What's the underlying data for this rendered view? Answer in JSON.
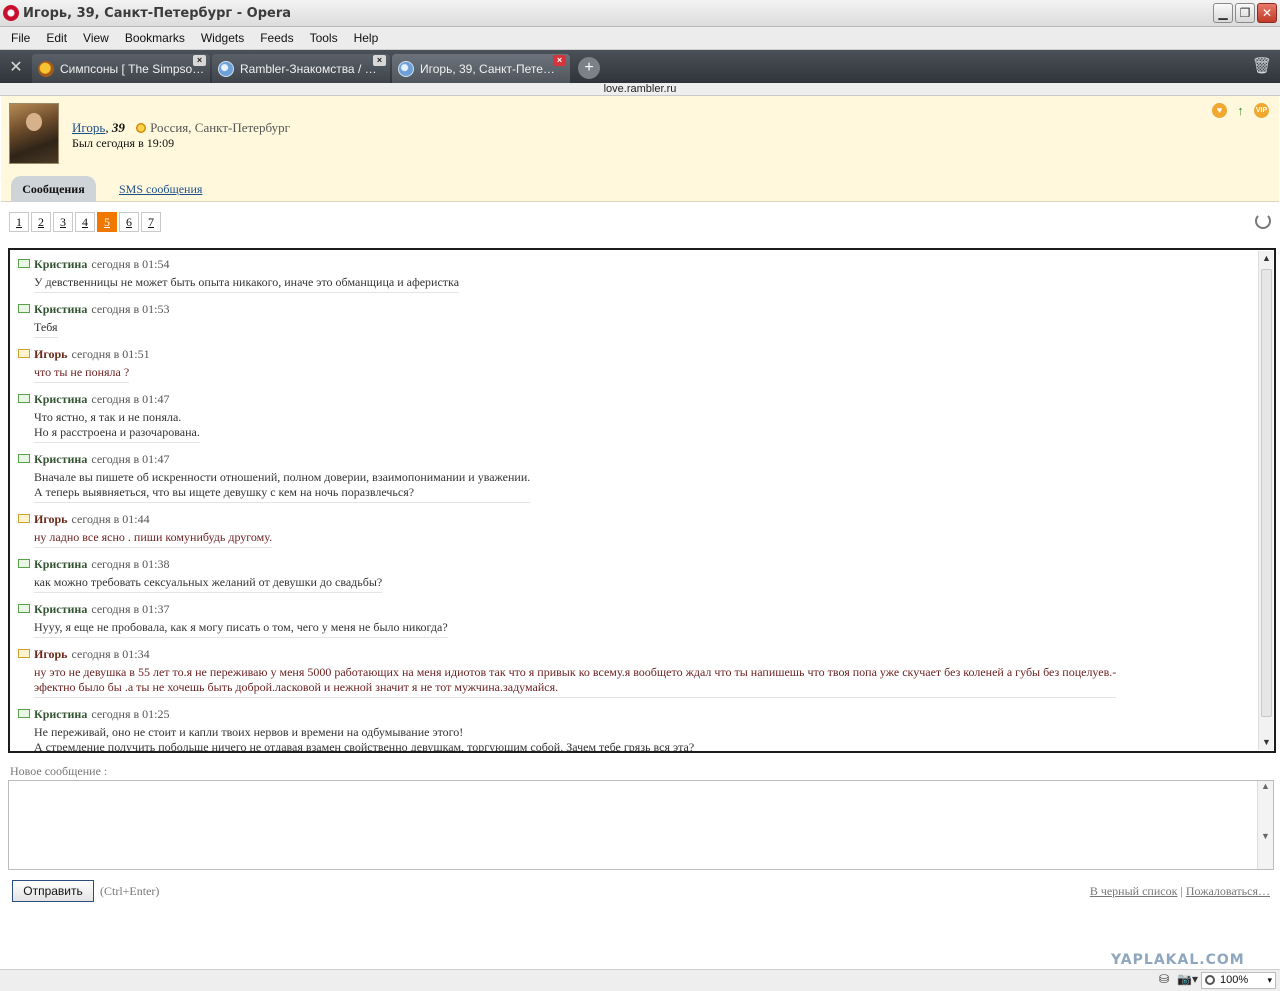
{
  "window": {
    "title": "Игорь, 39, Санкт-Петербург - Opera"
  },
  "menu": [
    "File",
    "Edit",
    "View",
    "Bookmarks",
    "Widgets",
    "Feeds",
    "Tools",
    "Help"
  ],
  "tabs": [
    {
      "label": "Симпсоны [ The Simpso…",
      "active": false
    },
    {
      "label": "Rambler-Знакомства / …",
      "active": false
    },
    {
      "label": "Игорь, 39, Санкт-Пете…",
      "active": true
    }
  ],
  "address": "love.rambler.ru",
  "profile": {
    "name": "Игорь",
    "separator": ",",
    "age": "39",
    "location": "Россия, Санкт-Петербург",
    "last_seen": "Был сегодня в 19:09"
  },
  "section_tabs": {
    "messages": "Сообщения",
    "sms": "SMS сообщения"
  },
  "pager": {
    "pages": [
      "1",
      "2",
      "3",
      "4",
      "5",
      "6",
      "7"
    ],
    "active": "5"
  },
  "messages": [
    {
      "author": "Кристина",
      "time": "сегодня в 01:54",
      "me": false,
      "lines": [
        "У девственницы не может быть опыта никакого, иначе это обманщица и аферистка"
      ]
    },
    {
      "author": "Кристина",
      "time": "сегодня в 01:53",
      "me": false,
      "lines": [
        "Тебя"
      ]
    },
    {
      "author": "Игорь",
      "time": "сегодня в 01:51",
      "me": true,
      "lines": [
        "что ты не поняла ?"
      ]
    },
    {
      "author": "Кристина",
      "time": "сегодня в 01:47",
      "me": false,
      "lines": [
        "Что ястно, я так и не поняла.",
        "Но я расстроена и разочарована."
      ]
    },
    {
      "author": "Кристина",
      "time": "сегодня в 01:47",
      "me": false,
      "lines": [
        "Вначале вы пишете об искренности отношений, полном доверии, взаимопонимании и уважении.",
        "А теперь выявняеться, что вы ищете девушку с кем на ночь поразвлечься?"
      ]
    },
    {
      "author": "Игорь",
      "time": "сегодня в 01:44",
      "me": true,
      "lines": [
        "ну ладно все ясно . пиши комунибудь другому."
      ]
    },
    {
      "author": "Кристина",
      "time": "сегодня в 01:38",
      "me": false,
      "lines": [
        "как можно требовать сексуальных желаний от девушки до свадьбы?"
      ]
    },
    {
      "author": "Кристина",
      "time": "сегодня в 01:37",
      "me": false,
      "lines": [
        "Нууу, я еще не пробовала, как я могу писать о том, чего у меня не было никогда?"
      ]
    },
    {
      "author": "Игорь",
      "time": "сегодня в 01:34",
      "me": true,
      "lines": [
        "ну это не девушка в 55 лет то.я не переживаю у меня 5000 работающих на меня идиотов так что я привык ко всему.я вообщето ждал что ты напишешь что твоя попа уже скучает без коленей а губы без поцелуев.-",
        "эфектно было бы .а ты не хочешь быть доброй.ласковой и нежной значит я не тот мужчина.задумайся."
      ]
    },
    {
      "author": "Кристина",
      "time": "сегодня в 01:25",
      "me": false,
      "lines": [
        "Не переживай, оно не стоит и капли твоих нервов и времени на одбумывание этого!",
        "А стремление получить побольше ничего не отдавая взамен свойственно девушкам, торгующим собой. Зачем тебе грязь вся эта?"
      ]
    }
  ],
  "compose": {
    "label": "Новое сообщение :",
    "send": "Отправить",
    "hotkey": "(Ctrl+Enter)",
    "blacklist": "В черный список",
    "separator": "|",
    "report": "Пожаловаться…"
  },
  "watermark": "YAPLAKAL.COM",
  "status": {
    "zoom": "100%"
  }
}
